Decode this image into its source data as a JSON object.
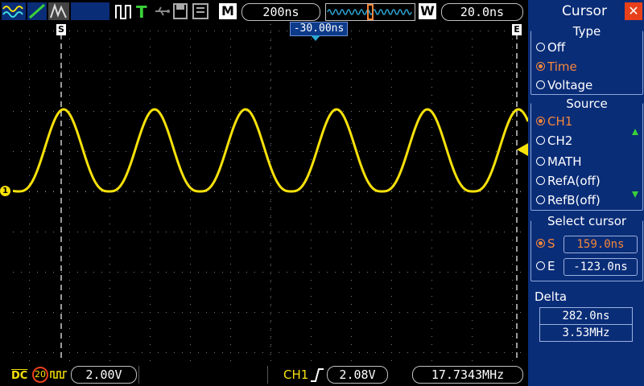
{
  "colors": {
    "trace": "#f7e10a",
    "panel_bg": "#0a2d78",
    "selected": "#f5873a",
    "grid": "#8a8a8a"
  },
  "toolbar": {
    "icons": [
      "waveform-icon",
      "slope-icon",
      "gray-wave-icon",
      "run-stop-icon",
      "trigger-T-icon",
      "usb-icon",
      "save-icon",
      "memory-icon"
    ],
    "time_base_label": "M",
    "time_base_value": "200ns",
    "window_label": "W",
    "window_value": "20.0ns"
  },
  "plot": {
    "trigger_position": "-30.00ns",
    "cursor_s_label": "S",
    "cursor_e_label": "E",
    "ch1_marker": "1"
  },
  "bottom": {
    "coupling": "DC",
    "bw_limit": "20",
    "ch1_scale": "2.00V",
    "trigger_source": "CH1",
    "trigger_level": "2.08V",
    "frequency": "17.7343MHz"
  },
  "panel": {
    "title": "Cursor",
    "type_title": "Type",
    "type_options": [
      {
        "label": "Off",
        "selected": false
      },
      {
        "label": "Time",
        "selected": true
      },
      {
        "label": "Voltage",
        "selected": false
      }
    ],
    "source_title": "Source",
    "source_options": [
      {
        "label": "CH1",
        "selected": true
      },
      {
        "label": "CH2",
        "selected": false
      },
      {
        "label": "MATH",
        "selected": false
      },
      {
        "label": "RefA(off)",
        "selected": false
      },
      {
        "label": "RefB(off)",
        "selected": false
      }
    ],
    "select_title": "Select cursor",
    "cursor_s": {
      "label": "S",
      "value": "159.0ns",
      "selected": true
    },
    "cursor_e": {
      "label": "E",
      "value": "-123.0ns",
      "selected": false
    },
    "delta_title": "Delta",
    "delta_time": "282.0ns",
    "delta_freq": "3.53MHz"
  }
}
